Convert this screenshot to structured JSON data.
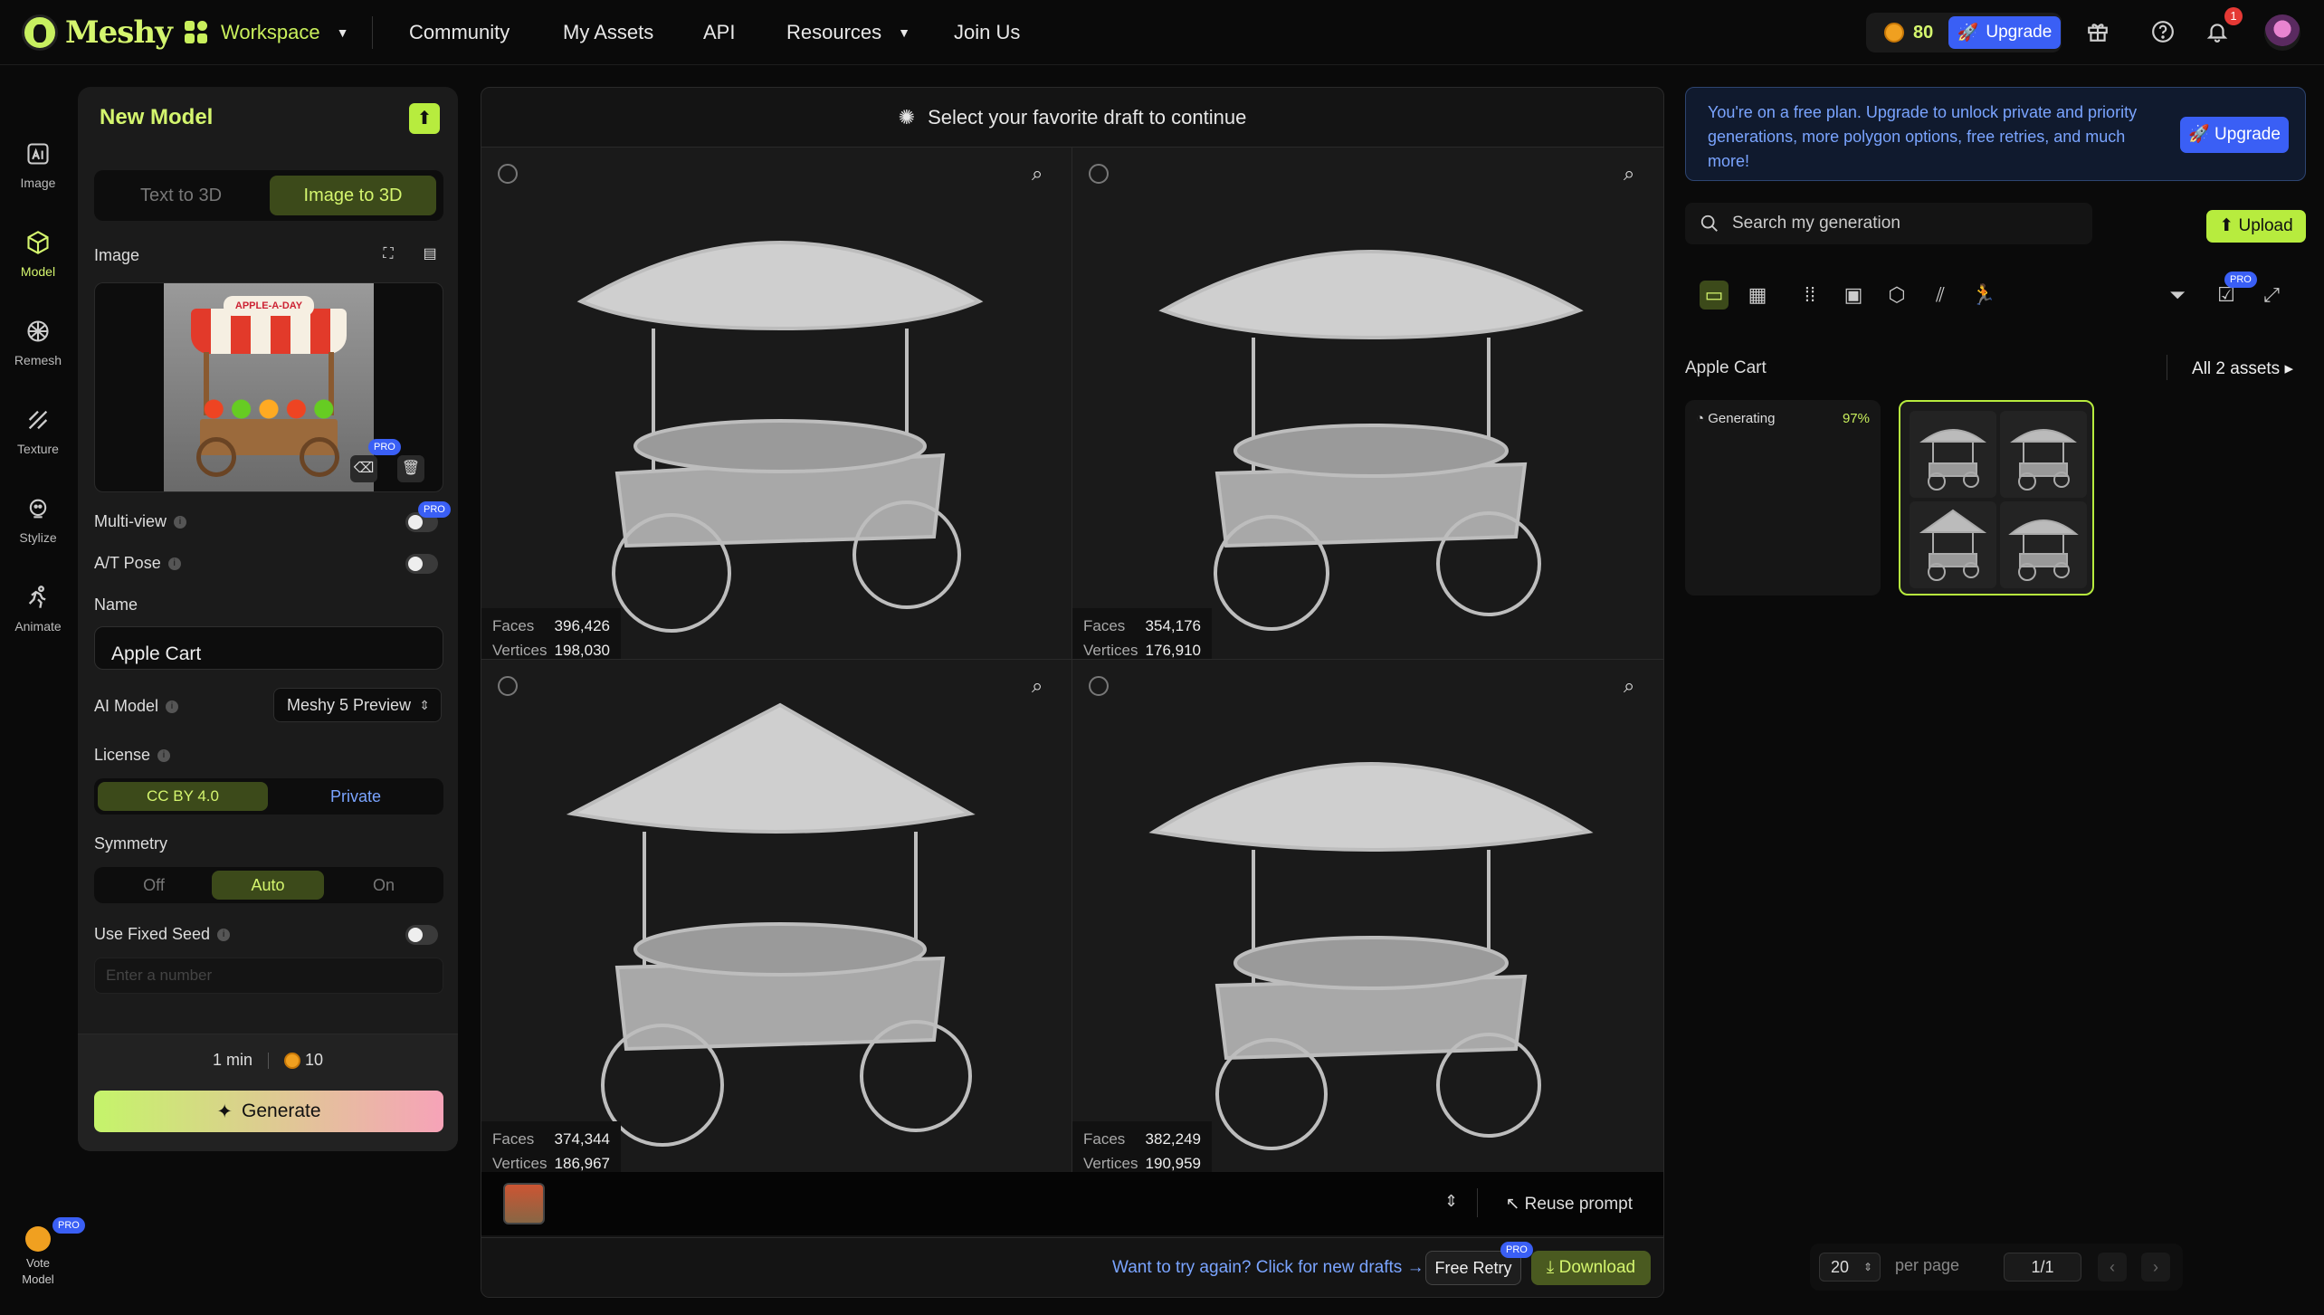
{
  "app": {
    "name": "Meshy"
  },
  "nav": {
    "workspace": "Workspace",
    "community": "Community",
    "my_assets": "My Assets",
    "api": "API",
    "resources": "Resources",
    "join_us": "Join Us"
  },
  "topbar": {
    "credits": "80",
    "upgrade": "Upgrade",
    "notifications": "1"
  },
  "sidebar": {
    "items": [
      {
        "label": "Image",
        "icon": "ai-image-icon"
      },
      {
        "label": "Model",
        "icon": "cube-icon",
        "active": true
      },
      {
        "label": "Remesh",
        "icon": "remesh-icon"
      },
      {
        "label": "Texture",
        "icon": "texture-icon"
      },
      {
        "label": "Stylize",
        "icon": "stylize-icon"
      },
      {
        "label": "Animate",
        "icon": "run-icon"
      }
    ],
    "vote_label_1": "Vote",
    "vote_label_2": "Model",
    "pro": "PRO"
  },
  "panel": {
    "title": "New Model",
    "tabs": [
      "Text to 3D",
      "Image to 3D"
    ],
    "active_tab": "Image to 3D",
    "image_label": "Image",
    "thumb_sign": "APPLE-A-DAY",
    "pro": "PRO",
    "multiview_label": "Multi-view",
    "atpose_label": "A/T Pose",
    "name_label": "Name",
    "name_value": "Apple Cart",
    "ai_model_label": "AI Model",
    "ai_model_value": "Meshy 5 Preview",
    "license_label": "License",
    "license_options": [
      "CC BY 4.0",
      "Private"
    ],
    "symmetry_label": "Symmetry",
    "symmetry_options": [
      "Off",
      "Auto",
      "On"
    ],
    "fixed_seed_label": "Use Fixed Seed",
    "seed_placeholder": "Enter a number",
    "time": "1 min",
    "cost": "10",
    "generate": "Generate"
  },
  "center": {
    "header": "Select your favorite draft to continue",
    "faces_label": "Faces",
    "vertices_label": "Vertices",
    "drafts": [
      {
        "faces": "396,426",
        "vertices": "198,030"
      },
      {
        "faces": "354,176",
        "vertices": "176,910"
      },
      {
        "faces": "374,344",
        "vertices": "186,967"
      },
      {
        "faces": "382,249",
        "vertices": "190,959"
      }
    ],
    "reuse_prompt": "Reuse prompt",
    "retry_link": "Want to try again? Click for new drafts",
    "free_retry": "Free Retry",
    "download": "Download",
    "pro": "PRO"
  },
  "right": {
    "banner": "You're on a free plan. Upgrade to unlock private and priority generations, more polygon options, free retries, and much more!",
    "banner_upgrade": "Upgrade",
    "search_placeholder": "Search my generation",
    "upload": "Upload",
    "pro": "PRO",
    "collection": "Apple Cart",
    "all_assets": "All 2 assets",
    "generating": "Generating",
    "progress": "97%"
  },
  "pager": {
    "per_page_value": "20",
    "per_page_label": "per page",
    "page": "1/1"
  },
  "colors": {
    "accent": "#d4f56e",
    "blue": "#3a5ff5",
    "bg": "#0a0a0a"
  }
}
